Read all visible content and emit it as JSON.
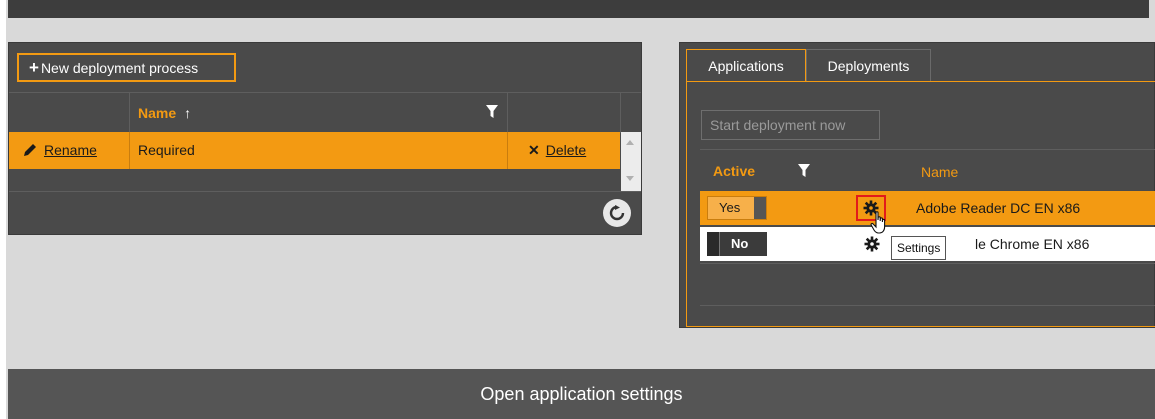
{
  "left_panel": {
    "new_button_plus": "+",
    "new_button_label": "New deployment process",
    "column_name": "Name",
    "sort_arrow": "↑",
    "row": {
      "rename_label": "Rename",
      "name": "Required",
      "delete_label": "Delete"
    }
  },
  "right_panel": {
    "tabs": [
      {
        "label": "Applications",
        "active": true
      },
      {
        "label": "Deployments",
        "active": false
      }
    ],
    "start_button_label": "Start deployment now",
    "column_active": "Active",
    "column_name": "Name",
    "rows": [
      {
        "active_label": "Yes",
        "app_name": "Adobe Reader DC EN x86"
      },
      {
        "active_label": "No",
        "app_name": "le Chrome EN x86"
      }
    ],
    "tooltip": "Settings"
  },
  "caption": "Open application settings",
  "colors": {
    "accent": "#f39a12",
    "panel": "#4a4a4a",
    "highlight": "#e21b1b"
  }
}
